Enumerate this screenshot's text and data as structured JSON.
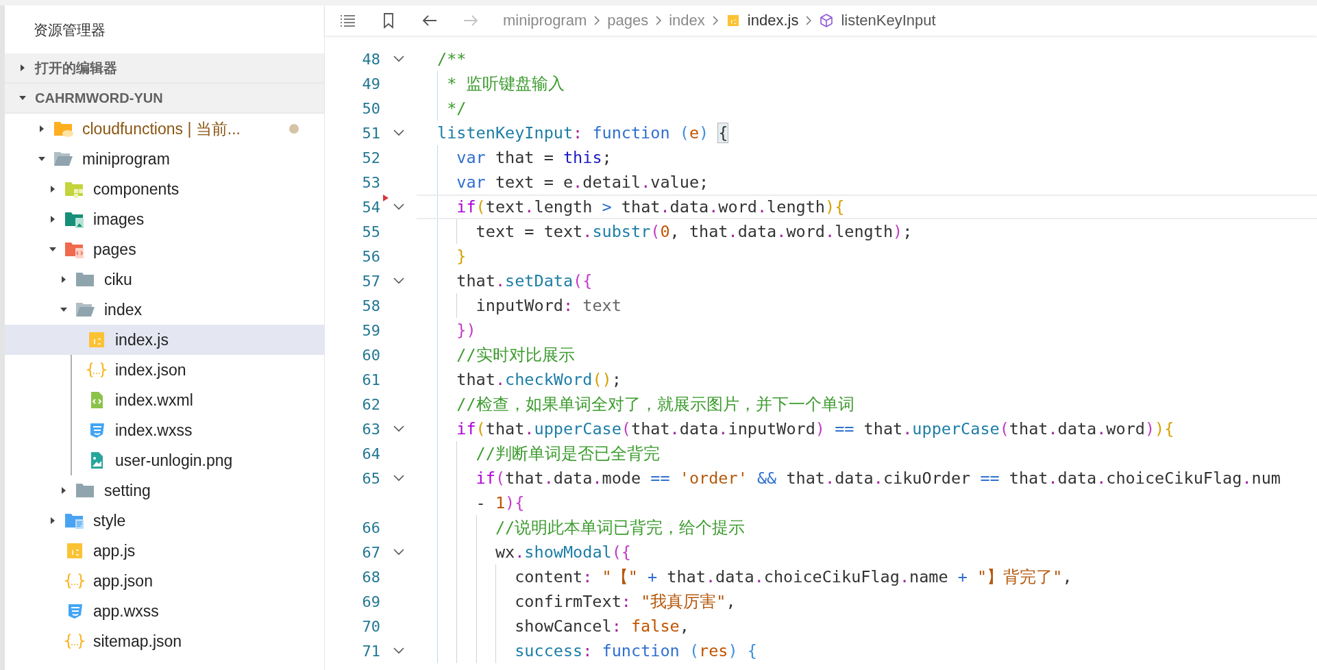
{
  "explorer": {
    "title": "资源管理器",
    "sections": [
      {
        "label": "打开的编辑器",
        "expanded": false
      },
      {
        "label": "CAHRMWORD-YUN",
        "expanded": true,
        "children": [
          {
            "label": "cloudfunctions | 当前...",
            "kind": "folder-cloud",
            "expanded": false,
            "selected": false,
            "modified": true
          },
          {
            "label": "miniprogram",
            "kind": "folder",
            "expanded": true,
            "selected": false,
            "modified": false,
            "children": [
              {
                "label": "components",
                "kind": "folder-components",
                "expanded": false,
                "selected": false,
                "modified": false
              },
              {
                "label": "images",
                "kind": "folder-images",
                "expanded": false,
                "selected": false,
                "modified": false
              },
              {
                "label": "pages",
                "kind": "folder-pages",
                "expanded": true,
                "selected": false,
                "modified": false,
                "children": [
                  {
                    "label": "ciku",
                    "kind": "folder",
                    "expanded": false,
                    "selected": false,
                    "modified": false
                  },
                  {
                    "label": "index",
                    "kind": "folder",
                    "expanded": true,
                    "selected": false,
                    "modified": false,
                    "children": [
                      {
                        "label": "index.js",
                        "kind": "js",
                        "selected": true,
                        "modified": false
                      },
                      {
                        "label": "index.json",
                        "kind": "json",
                        "selected": false,
                        "modified": false
                      },
                      {
                        "label": "index.wxml",
                        "kind": "wxml",
                        "selected": false,
                        "modified": false
                      },
                      {
                        "label": "index.wxss",
                        "kind": "wxss",
                        "selected": false,
                        "modified": false
                      },
                      {
                        "label": "user-unlogin.png",
                        "kind": "png",
                        "selected": false,
                        "modified": false
                      }
                    ]
                  },
                  {
                    "label": "setting",
                    "kind": "folder",
                    "expanded": false,
                    "selected": false,
                    "modified": false
                  }
                ]
              },
              {
                "label": "style",
                "kind": "folder-style",
                "expanded": false,
                "selected": false,
                "modified": false
              },
              {
                "label": "app.js",
                "kind": "js",
                "selected": false,
                "modified": false
              },
              {
                "label": "app.json",
                "kind": "json",
                "selected": false,
                "modified": false
              },
              {
                "label": "app.wxss",
                "kind": "wxss",
                "selected": false,
                "modified": false
              },
              {
                "label": "sitemap.json",
                "kind": "json",
                "selected": false,
                "modified": false
              }
            ]
          }
        ]
      }
    ]
  },
  "editor": {
    "toolbar": [
      {
        "kind": "outline",
        "disabled": false
      },
      {
        "kind": "bookmark",
        "disabled": false
      },
      {
        "kind": "back",
        "disabled": false
      },
      {
        "kind": "forward",
        "disabled": true
      }
    ],
    "breadcrumb": [
      {
        "label": "miniprogram",
        "kind": "folder"
      },
      {
        "label": "pages",
        "kind": "folder"
      },
      {
        "label": "index",
        "kind": "folder"
      },
      {
        "label": "index.js",
        "kind": "file"
      },
      {
        "label": "listenKeyInput",
        "kind": "symbol"
      }
    ],
    "code_lines": [
      {
        "number": "48",
        "fold": true,
        "current": false,
        "marked": false,
        "tokens": [
          {
            "text": "/**",
            "kind": "comment"
          }
        ]
      },
      {
        "number": "49",
        "fold": false,
        "current": false,
        "marked": false,
        "tokens": [
          {
            "text": " * 监听键盘输入",
            "kind": "comment"
          }
        ]
      },
      {
        "number": "50",
        "fold": false,
        "current": false,
        "marked": false,
        "tokens": [
          {
            "text": " */",
            "kind": "comment"
          }
        ]
      },
      {
        "number": "51",
        "fold": true,
        "current": false,
        "marked": false,
        "tokens": [
          {
            "text": "listenKeyInput",
            "kind": "method"
          },
          {
            "text": ":",
            "kind": "punct"
          },
          {
            "text": " function",
            "kind": "keyword"
          },
          {
            "text": " (",
            "kind": "bracket3"
          },
          {
            "text": "e",
            "kind": "number"
          },
          {
            "text": ") ",
            "kind": "bracket3"
          },
          {
            "text": "{",
            "kind": "match"
          }
        ]
      },
      {
        "number": "52",
        "fold": false,
        "current": false,
        "marked": false,
        "tokens": [
          {
            "text": "  var",
            "kind": "keyword"
          },
          {
            "text": " that = ",
            "kind": "plain"
          },
          {
            "text": "this",
            "kind": "self"
          },
          {
            "text": ";",
            "kind": "plain"
          }
        ]
      },
      {
        "number": "53",
        "fold": false,
        "current": false,
        "marked": false,
        "tokens": [
          {
            "text": "  var",
            "kind": "keyword"
          },
          {
            "text": " text = e",
            "kind": "plain"
          },
          {
            "text": ".",
            "kind": "punct"
          },
          {
            "text": "detail",
            "kind": "plain"
          },
          {
            "text": ".",
            "kind": "punct"
          },
          {
            "text": "value;",
            "kind": "plain"
          }
        ]
      },
      {
        "number": "54",
        "fold": true,
        "current": true,
        "marked": true,
        "tokens": [
          {
            "text": "  if",
            "kind": "control"
          },
          {
            "text": "(",
            "kind": "bracket1"
          },
          {
            "text": "text",
            "kind": "plain"
          },
          {
            "text": ".",
            "kind": "punct"
          },
          {
            "text": "length ",
            "kind": "plain"
          },
          {
            "text": ">",
            "kind": "operator"
          },
          {
            "text": " that",
            "kind": "plain"
          },
          {
            "text": ".",
            "kind": "punct"
          },
          {
            "text": "data",
            "kind": "plain"
          },
          {
            "text": ".",
            "kind": "punct"
          },
          {
            "text": "word",
            "kind": "plain"
          },
          {
            "text": ".",
            "kind": "punct"
          },
          {
            "text": "length",
            "kind": "plain"
          },
          {
            "text": "){",
            "kind": "bracket1"
          }
        ]
      },
      {
        "number": "55",
        "fold": false,
        "current": false,
        "marked": false,
        "tokens": [
          {
            "text": "    text = text",
            "kind": "plain"
          },
          {
            "text": ".",
            "kind": "punct"
          },
          {
            "text": "substr",
            "kind": "method"
          },
          {
            "text": "(",
            "kind": "bracket2"
          },
          {
            "text": "0",
            "kind": "number"
          },
          {
            "text": ", that",
            "kind": "plain"
          },
          {
            "text": ".",
            "kind": "punct"
          },
          {
            "text": "data",
            "kind": "plain"
          },
          {
            "text": ".",
            "kind": "punct"
          },
          {
            "text": "word",
            "kind": "plain"
          },
          {
            "text": ".",
            "kind": "punct"
          },
          {
            "text": "length",
            "kind": "plain"
          },
          {
            "text": ")",
            "kind": "bracket2"
          },
          {
            "text": ";",
            "kind": "plain"
          }
        ]
      },
      {
        "number": "56",
        "fold": false,
        "current": false,
        "marked": false,
        "tokens": [
          {
            "text": "  }",
            "kind": "bracket1"
          }
        ]
      },
      {
        "number": "57",
        "fold": true,
        "current": false,
        "marked": false,
        "tokens": [
          {
            "text": "  that",
            "kind": "plain"
          },
          {
            "text": ".",
            "kind": "punct"
          },
          {
            "text": "setData",
            "kind": "method"
          },
          {
            "text": "({",
            "kind": "bracket2"
          }
        ]
      },
      {
        "number": "58",
        "fold": false,
        "current": false,
        "marked": false,
        "tokens": [
          {
            "text": "    inputWord",
            "kind": "plain"
          },
          {
            "text": ":",
            "kind": "punct"
          },
          {
            "text": " text",
            "kind": "muted"
          }
        ]
      },
      {
        "number": "59",
        "fold": false,
        "current": false,
        "marked": false,
        "tokens": [
          {
            "text": "  })",
            "kind": "bracket2"
          }
        ]
      },
      {
        "number": "60",
        "fold": false,
        "current": false,
        "marked": false,
        "tokens": [
          {
            "text": "  //实时对比展示",
            "kind": "comment"
          }
        ]
      },
      {
        "number": "61",
        "fold": false,
        "current": false,
        "marked": false,
        "tokens": [
          {
            "text": "  that",
            "kind": "plain"
          },
          {
            "text": ".",
            "kind": "punct"
          },
          {
            "text": "checkWord",
            "kind": "method"
          },
          {
            "text": "()",
            "kind": "bracket1"
          },
          {
            "text": ";",
            "kind": "plain"
          }
        ]
      },
      {
        "number": "62",
        "fold": false,
        "current": false,
        "marked": false,
        "tokens": [
          {
            "text": "  //检查，如果单词全对了，就展示图片，并下一个单词",
            "kind": "comment"
          }
        ]
      },
      {
        "number": "63",
        "fold": true,
        "current": false,
        "marked": false,
        "tokens": [
          {
            "text": "  if",
            "kind": "control"
          },
          {
            "text": "(",
            "kind": "bracket1"
          },
          {
            "text": "that",
            "kind": "plain"
          },
          {
            "text": ".",
            "kind": "punct"
          },
          {
            "text": "upperCase",
            "kind": "method"
          },
          {
            "text": "(",
            "kind": "bracket2"
          },
          {
            "text": "that",
            "kind": "plain"
          },
          {
            "text": ".",
            "kind": "punct"
          },
          {
            "text": "data",
            "kind": "plain"
          },
          {
            "text": ".",
            "kind": "punct"
          },
          {
            "text": "inputWord",
            "kind": "plain"
          },
          {
            "text": ")",
            "kind": "bracket2"
          },
          {
            "text": " ==",
            "kind": "operator"
          },
          {
            "text": " that",
            "kind": "plain"
          },
          {
            "text": ".",
            "kind": "punct"
          },
          {
            "text": "upperCase",
            "kind": "method"
          },
          {
            "text": "(",
            "kind": "bracket2"
          },
          {
            "text": "that",
            "kind": "plain"
          },
          {
            "text": ".",
            "kind": "punct"
          },
          {
            "text": "data",
            "kind": "plain"
          },
          {
            "text": ".",
            "kind": "punct"
          },
          {
            "text": "word",
            "kind": "plain"
          },
          {
            "text": ")",
            "kind": "bracket2"
          },
          {
            "text": "){",
            "kind": "bracket1"
          }
        ]
      },
      {
        "number": "64",
        "fold": false,
        "current": false,
        "marked": false,
        "tokens": [
          {
            "text": "    //判断单词是否已全背完",
            "kind": "comment"
          }
        ]
      },
      {
        "number": "65",
        "fold": true,
        "current": false,
        "marked": false,
        "tokens": [
          {
            "text": "    if",
            "kind": "control"
          },
          {
            "text": "(",
            "kind": "bracket2"
          },
          {
            "text": "that",
            "kind": "plain"
          },
          {
            "text": ".",
            "kind": "punct"
          },
          {
            "text": "data",
            "kind": "plain"
          },
          {
            "text": ".",
            "kind": "punct"
          },
          {
            "text": "mode ",
            "kind": "plain"
          },
          {
            "text": "==",
            "kind": "operator"
          },
          {
            "text": " 'order'",
            "kind": "string"
          },
          {
            "text": " &&",
            "kind": "operator"
          },
          {
            "text": " that",
            "kind": "plain"
          },
          {
            "text": ".",
            "kind": "punct"
          },
          {
            "text": "data",
            "kind": "plain"
          },
          {
            "text": ".",
            "kind": "punct"
          },
          {
            "text": "cikuOrder ",
            "kind": "plain"
          },
          {
            "text": "==",
            "kind": "operator"
          },
          {
            "text": " that",
            "kind": "plain"
          },
          {
            "text": ".",
            "kind": "punct"
          },
          {
            "text": "data",
            "kind": "plain"
          },
          {
            "text": ".",
            "kind": "punct"
          },
          {
            "text": "choiceCikuFlag",
            "kind": "plain"
          },
          {
            "text": ".",
            "kind": "punct"
          },
          {
            "text": "num",
            "kind": "plain"
          }
        ],
        "continuation": [
          {
            "text": "    - ",
            "kind": "plain"
          },
          {
            "text": "1",
            "kind": "number"
          },
          {
            "text": "){",
            "kind": "bracket2"
          }
        ]
      },
      {
        "number": "66",
        "fold": false,
        "current": false,
        "marked": false,
        "tokens": [
          {
            "text": "      //说明此本单词已背完，给个提示",
            "kind": "comment"
          }
        ]
      },
      {
        "number": "67",
        "fold": true,
        "current": false,
        "marked": false,
        "tokens": [
          {
            "text": "      wx",
            "kind": "plain"
          },
          {
            "text": ".",
            "kind": "punct"
          },
          {
            "text": "showModal",
            "kind": "method"
          },
          {
            "text": "({",
            "kind": "bracket2"
          }
        ]
      },
      {
        "number": "68",
        "fold": false,
        "current": false,
        "marked": false,
        "tokens": [
          {
            "text": "        content",
            "kind": "plain"
          },
          {
            "text": ":",
            "kind": "punct"
          },
          {
            "text": " \"【\"",
            "kind": "string"
          },
          {
            "text": " +",
            "kind": "operator"
          },
          {
            "text": " that",
            "kind": "plain"
          },
          {
            "text": ".",
            "kind": "punct"
          },
          {
            "text": "data",
            "kind": "plain"
          },
          {
            "text": ".",
            "kind": "punct"
          },
          {
            "text": "choiceCikuFlag",
            "kind": "plain"
          },
          {
            "text": ".",
            "kind": "punct"
          },
          {
            "text": "name ",
            "kind": "plain"
          },
          {
            "text": "+",
            "kind": "operator"
          },
          {
            "text": " \"】背完了\"",
            "kind": "string"
          },
          {
            "text": ",",
            "kind": "plain"
          }
        ]
      },
      {
        "number": "69",
        "fold": false,
        "current": false,
        "marked": false,
        "tokens": [
          {
            "text": "        confirmText",
            "kind": "plain"
          },
          {
            "text": ":",
            "kind": "punct"
          },
          {
            "text": " \"我真厉害\"",
            "kind": "string"
          },
          {
            "text": ",",
            "kind": "plain"
          }
        ]
      },
      {
        "number": "70",
        "fold": false,
        "current": false,
        "marked": false,
        "tokens": [
          {
            "text": "        showCancel",
            "kind": "plain"
          },
          {
            "text": ":",
            "kind": "punct"
          },
          {
            "text": " false",
            "kind": "number"
          },
          {
            "text": ",",
            "kind": "plain"
          }
        ]
      },
      {
        "number": "71",
        "fold": true,
        "current": false,
        "marked": false,
        "tokens": [
          {
            "text": "        success",
            "kind": "method"
          },
          {
            "text": ":",
            "kind": "punct"
          },
          {
            "text": " function",
            "kind": "keyword"
          },
          {
            "text": " (",
            "kind": "bracket3"
          },
          {
            "text": "res",
            "kind": "number"
          },
          {
            "text": ")",
            "kind": "bracket3"
          },
          {
            "text": " {",
            "kind": "bracket3"
          }
        ]
      }
    ]
  }
}
